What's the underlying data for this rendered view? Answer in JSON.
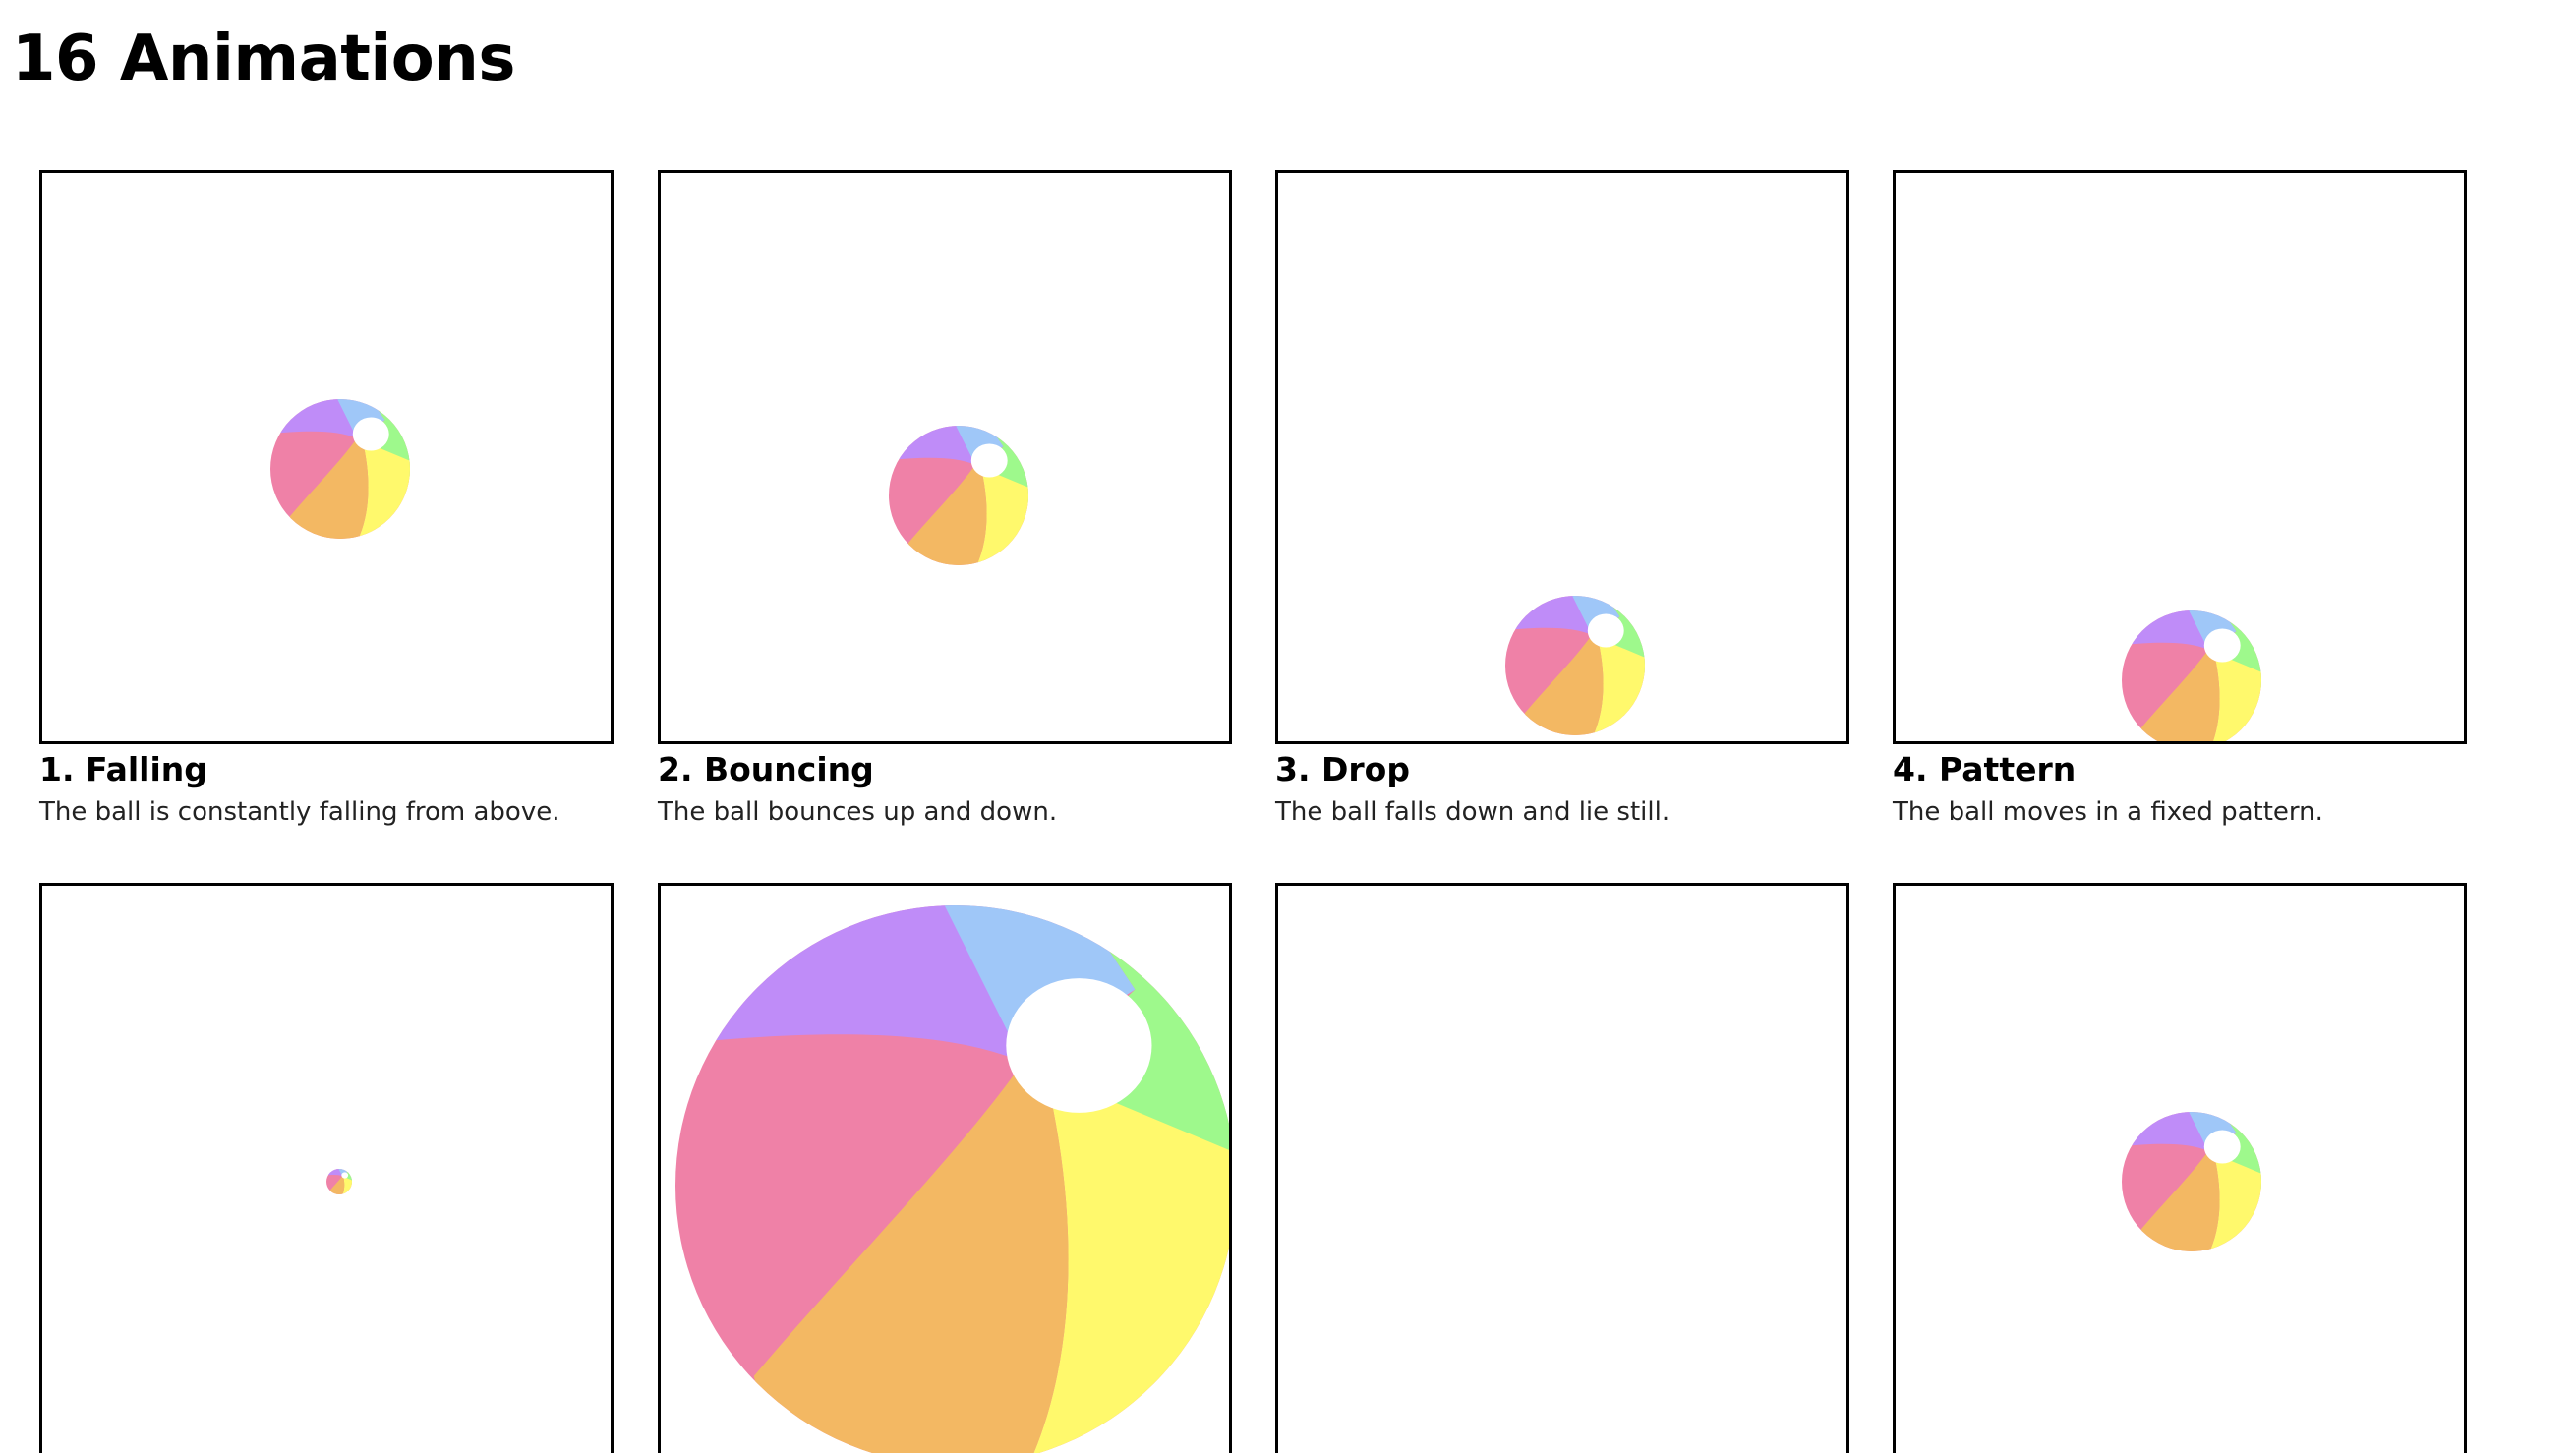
{
  "page": {
    "title": "16 Animations"
  },
  "colors": {
    "frame_border": "#000000",
    "ball_purple": "#bf8cf8",
    "ball_blue": "#9fc7f8",
    "ball_green": "#9ef98c",
    "ball_yellow": "#fff96c",
    "ball_orange": "#f3b863",
    "ball_pink": "#ef81a7",
    "ball_highlight": "#ffffff"
  },
  "animations": [
    {
      "title": "1. Falling",
      "description": "The ball is constantly falling from above."
    },
    {
      "title": "2. Bouncing",
      "description": "The ball bounces up and down."
    },
    {
      "title": "3. Drop",
      "description": "The ball falls down and lie still."
    },
    {
      "title": "4. Pattern",
      "description": "The ball moves in a fixed pattern."
    },
    {
      "title": "",
      "description": ""
    },
    {
      "title": "",
      "description": ""
    },
    {
      "title": "",
      "description": ""
    },
    {
      "title": "",
      "description": ""
    }
  ]
}
